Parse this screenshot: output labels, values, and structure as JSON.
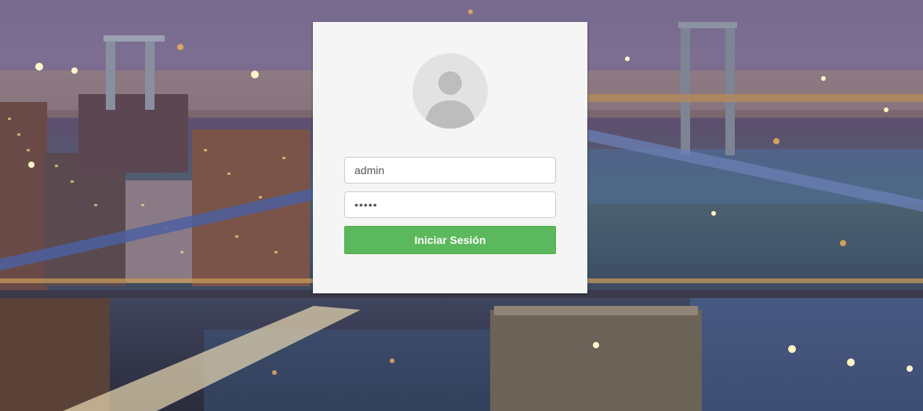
{
  "background": {
    "description_icon": "city-skyline-background"
  },
  "login": {
    "avatar_icon": "user-avatar-icon",
    "username_value": "admin",
    "password_value": "admin",
    "submit_label": "Iniciar Sesión",
    "accent_color": "#5cb85c"
  }
}
